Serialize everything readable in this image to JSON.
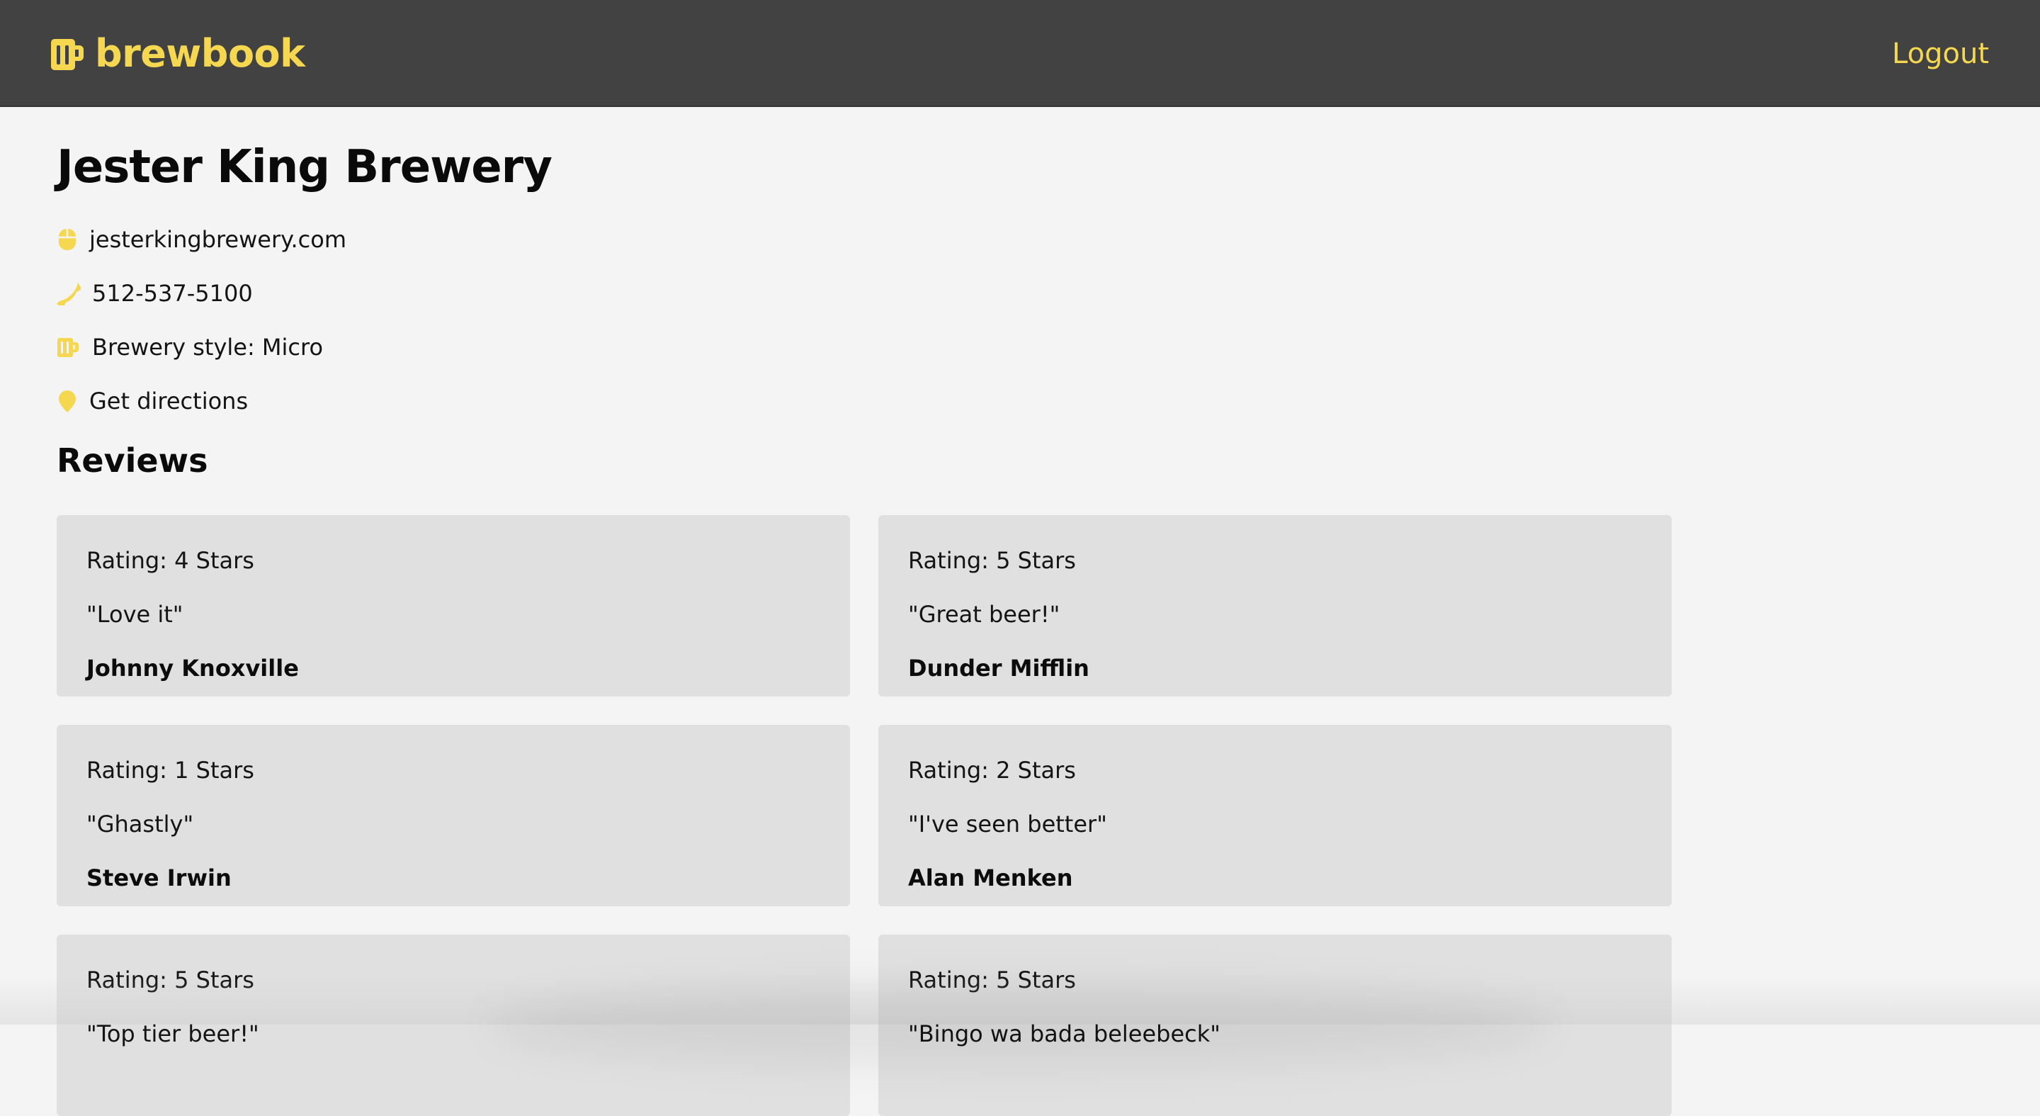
{
  "navbar": {
    "brand": "brewbook",
    "logout_label": "Logout",
    "brand_icon": "beer-mug-icon",
    "accent_color": "#f5d850",
    "background_color": "#424242"
  },
  "brewery": {
    "name": "Jester King Brewery",
    "website": "jesterkingbrewery.com",
    "phone": "512-537-5100",
    "style": "Brewery style: Micro",
    "directions": "Get directions"
  },
  "reviews": {
    "heading": "Reviews",
    "items": [
      {
        "rating": "Rating: 4 Stars",
        "quote": "\"Love it\"",
        "author": "Johnny Knoxville"
      },
      {
        "rating": "Rating: 5 Stars",
        "quote": "\"Great beer!\"",
        "author": "Dunder Mifflin"
      },
      {
        "rating": "Rating: 1 Stars",
        "quote": "\"Ghastly\"",
        "author": "Steve Irwin"
      },
      {
        "rating": "Rating: 2 Stars",
        "quote": "\"I've seen better\"",
        "author": "Alan Menken"
      },
      {
        "rating": "Rating: 5 Stars",
        "quote": "\"Top tier beer!\"",
        "author": ""
      },
      {
        "rating": "Rating: 5 Stars",
        "quote": "\"Bingo wa bada beleebeck\"",
        "author": ""
      }
    ]
  }
}
